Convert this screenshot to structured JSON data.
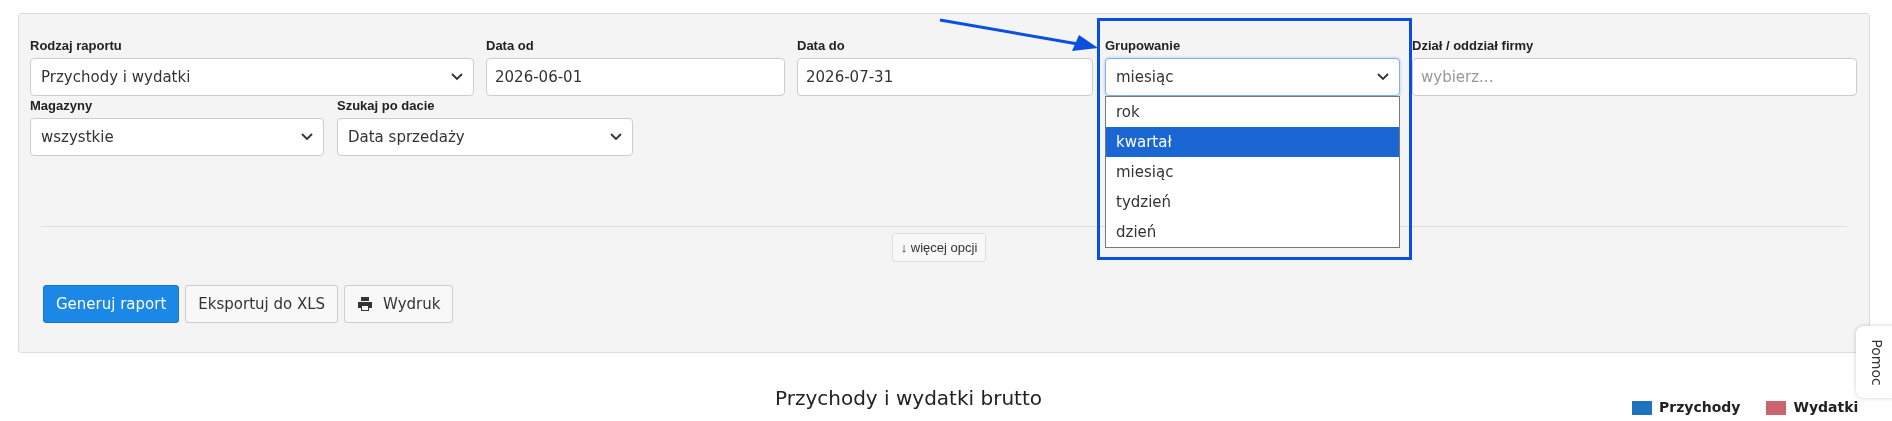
{
  "filters": {
    "report_type": {
      "label": "Rodzaj raportu",
      "value": "Przychody i wydatki"
    },
    "date_from": {
      "label": "Data od",
      "value": "2026-06-01"
    },
    "date_to": {
      "label": "Data do",
      "value": "2026-07-31"
    },
    "grouping": {
      "label": "Grupowanie",
      "value": "miesiąc",
      "expanded": true,
      "options": [
        {
          "label": "rok",
          "highlighted": false
        },
        {
          "label": "kwartał",
          "highlighted": true
        },
        {
          "label": "miesiąc",
          "highlighted": false
        },
        {
          "label": "tydzień",
          "highlighted": false
        },
        {
          "label": "dzień",
          "highlighted": false
        }
      ]
    },
    "department": {
      "label": "Dział / oddział firmy",
      "placeholder": "wybierz..."
    },
    "warehouses": {
      "label": "Magazyny",
      "value": "wszystkie"
    },
    "search_by_date": {
      "label": "Szukaj po dacie",
      "value": "Data sprzedaży"
    }
  },
  "more_options": {
    "arrow": "↓",
    "label": "więcej opcji"
  },
  "buttons": [
    {
      "kind": "primary",
      "label": "Generuj raport"
    },
    {
      "kind": "default",
      "label": "Eksportuj do XLS"
    },
    {
      "kind": "print",
      "label": "Wydruk"
    }
  ],
  "chart": {
    "title": "Przychody i wydatki brutto",
    "legend": [
      {
        "label": "Przychody",
        "color": "#1f72c0"
      },
      {
        "label": "Wydatki",
        "color": "#cd6570"
      }
    ]
  },
  "help_tab": "Pomoc"
}
